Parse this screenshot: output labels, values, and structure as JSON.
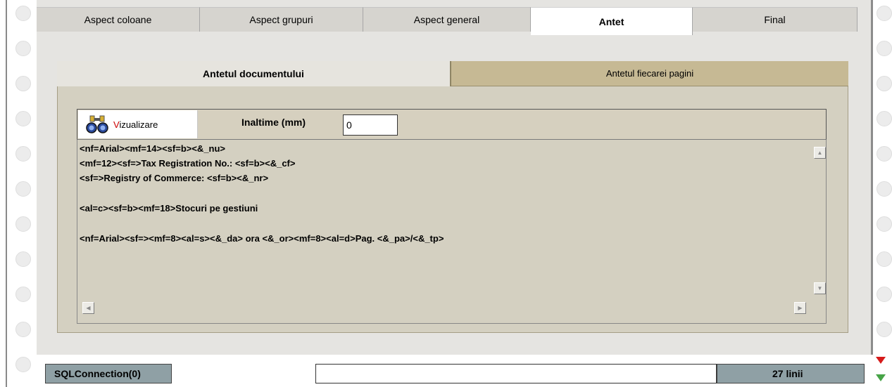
{
  "tabs": [
    {
      "label": "Aspect coloane"
    },
    {
      "label": "Aspect grupuri"
    },
    {
      "label": "Aspect general"
    },
    {
      "label": "Antet"
    },
    {
      "label": "Final"
    }
  ],
  "subtabs": {
    "active": "Antetul documentului",
    "inactive": "Antetul fiecarei pagini"
  },
  "toolbar": {
    "viz_first": "V",
    "viz_rest": "izualizare",
    "height_label": "Inaltime (mm)",
    "height_value": "0"
  },
  "editor": {
    "lines": [
      "<nf=Arial><mf=14><sf=b><&_nu>",
      "<mf=12><sf=>Tax Registration No.: <sf=b><&_cf>",
      "<sf=>Registry of Commerce: <sf=b><&_nr>",
      "<al=c><sf=b><mf=18>Stocuri pe gestiuni",
      "<nf=Arial><sf=><mf=8><al=s><&_da> ora <&_or><mf=8><al=d>Pag. <&_pa>/<&_tp>"
    ]
  },
  "status": {
    "connection": "SQLConnection(0)",
    "count": "27 linii"
  },
  "icons": [
    "binoculars-icon",
    "scroll-up-icon",
    "scroll-down-icon",
    "scroll-left-icon",
    "scroll-right-icon",
    "arrow-down-red-icon",
    "arrow-down-green-icon"
  ]
}
